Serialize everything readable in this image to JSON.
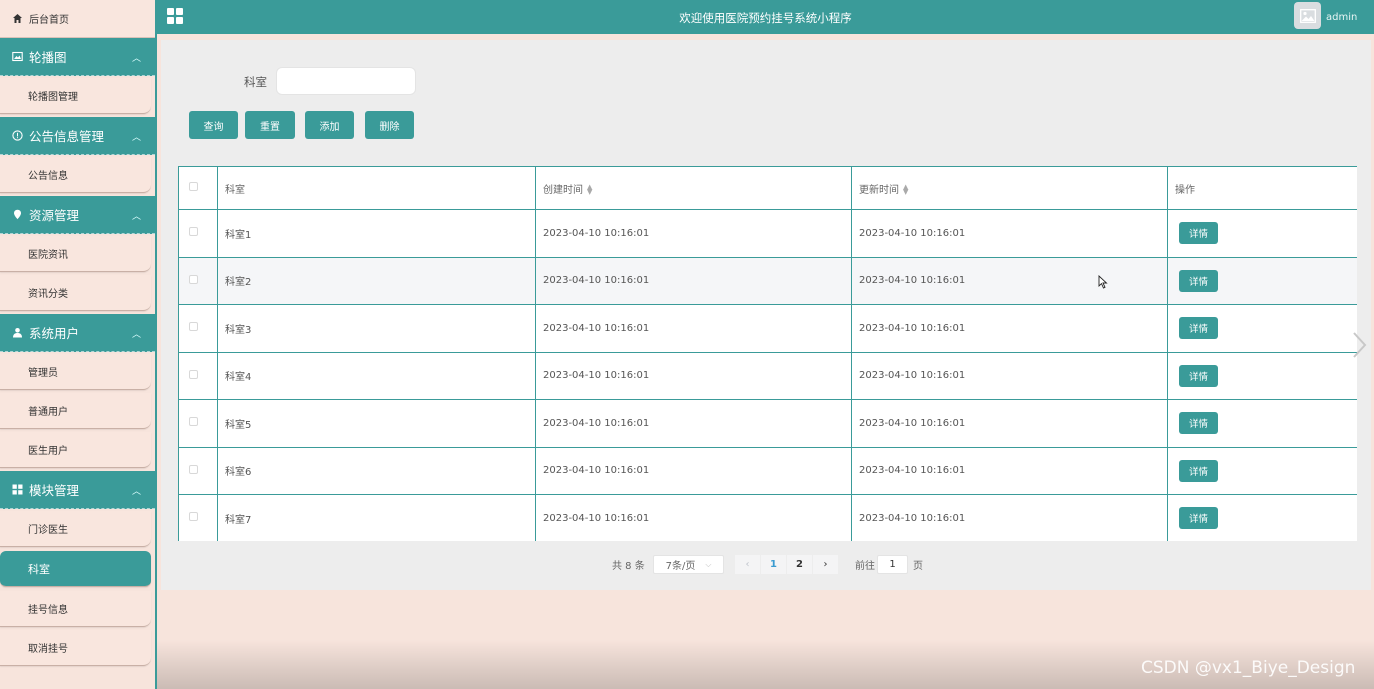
{
  "colors": {
    "accent": "#3a9b99",
    "sidebar_bg": "#f7e4dc",
    "panel_bg": "#ededed"
  },
  "sidebar": {
    "home_label": "后台首页",
    "groups": [
      {
        "label": "轮播图",
        "icon": "image-icon",
        "items": [
          "轮播图管理"
        ]
      },
      {
        "label": "公告信息管理",
        "icon": "info-icon",
        "items": [
          "公告信息"
        ]
      },
      {
        "label": "资源管理",
        "icon": "location-pin-icon",
        "items": [
          "医院资讯",
          "资讯分类"
        ]
      },
      {
        "label": "系统用户",
        "icon": "user-icon",
        "items": [
          "管理员",
          "普通用户",
          "医生用户"
        ]
      },
      {
        "label": "模块管理",
        "icon": "grid-icon",
        "items": [
          "门诊医生",
          "科室",
          "挂号信息",
          "取消挂号"
        ]
      }
    ],
    "active_item": "科室"
  },
  "header": {
    "title": "欢迎使用医院预约挂号系统小程序",
    "username": "admin"
  },
  "search": {
    "label": "科室",
    "value": ""
  },
  "toolbar": {
    "query": "查询",
    "reset": "重置",
    "add": "添加",
    "delete": "删除"
  },
  "table": {
    "columns": [
      "科室",
      "创建时间",
      "更新时间",
      "操作"
    ],
    "rows": [
      {
        "name": "科室1",
        "created": "2023-04-10 10:16:01",
        "updated": "2023-04-10 10:16:01",
        "action": "详情"
      },
      {
        "name": "科室2",
        "created": "2023-04-10 10:16:01",
        "updated": "2023-04-10 10:16:01",
        "action": "详情"
      },
      {
        "name": "科室3",
        "created": "2023-04-10 10:16:01",
        "updated": "2023-04-10 10:16:01",
        "action": "详情"
      },
      {
        "name": "科室4",
        "created": "2023-04-10 10:16:01",
        "updated": "2023-04-10 10:16:01",
        "action": "详情"
      },
      {
        "name": "科室5",
        "created": "2023-04-10 10:16:01",
        "updated": "2023-04-10 10:16:01",
        "action": "详情"
      },
      {
        "name": "科室6",
        "created": "2023-04-10 10:16:01",
        "updated": "2023-04-10 10:16:01",
        "action": "详情"
      },
      {
        "name": "科室7",
        "created": "2023-04-10 10:16:01",
        "updated": "2023-04-10 10:16:01",
        "action": "详情"
      }
    ]
  },
  "pagination": {
    "total": "共 8 条",
    "page_size": "7条/页",
    "pages": [
      "1",
      "2"
    ],
    "current": "1",
    "goto_prefix": "前往",
    "goto_value": "1",
    "goto_suffix": "页"
  },
  "watermark": "CSDN @vx1_Biye_Design"
}
